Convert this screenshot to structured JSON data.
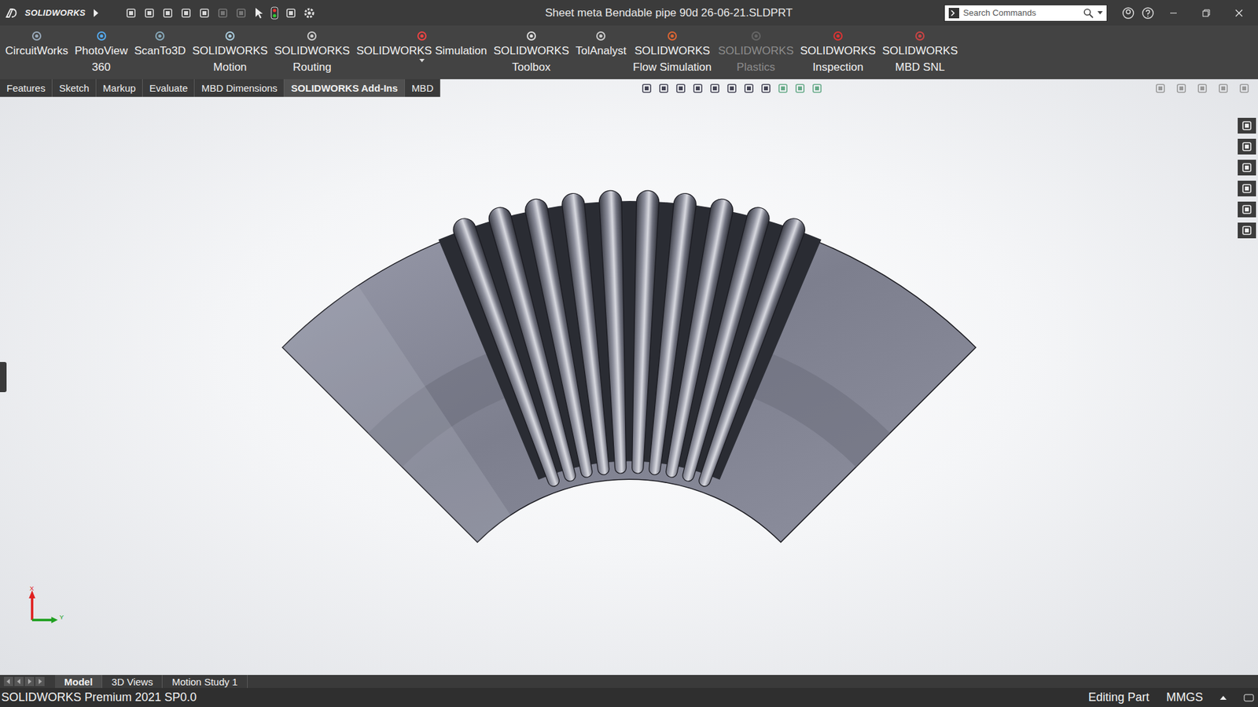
{
  "window": {
    "logo": "SOLIDWORKS",
    "title": "Sheet meta Bendable pipe 90d  26-06-21.SLDPRT"
  },
  "search": {
    "placeholder": "Search Commands"
  },
  "ribbon": [
    {
      "lines": [
        "CircuitWorks"
      ],
      "disabled": false,
      "menu": false
    },
    {
      "lines": [
        "PhotoView",
        "360"
      ],
      "disabled": false,
      "menu": false
    },
    {
      "lines": [
        "ScanTo3D"
      ],
      "disabled": false,
      "menu": false
    },
    {
      "lines": [
        "SOLIDWORKS",
        "Motion"
      ],
      "disabled": false,
      "menu": false
    },
    {
      "lines": [
        "SOLIDWORKS",
        "Routing"
      ],
      "disabled": false,
      "menu": false
    },
    {
      "lines": [
        "SOLIDWORKS Simulation"
      ],
      "disabled": false,
      "menu": true
    },
    {
      "lines": [
        "SOLIDWORKS",
        "Toolbox"
      ],
      "disabled": false,
      "menu": false
    },
    {
      "lines": [
        "TolAnalyst"
      ],
      "disabled": false,
      "menu": false
    },
    {
      "lines": [
        "SOLIDWORKS",
        "Flow Simulation"
      ],
      "disabled": false,
      "menu": false
    },
    {
      "lines": [
        "SOLIDWORKS",
        "Plastics"
      ],
      "disabled": true,
      "menu": false
    },
    {
      "lines": [
        "SOLIDWORKS",
        "Inspection"
      ],
      "disabled": false,
      "menu": false
    },
    {
      "lines": [
        "SOLIDWORKS",
        "MBD SNL"
      ],
      "disabled": false,
      "menu": false
    }
  ],
  "tabs": [
    {
      "label": "Features",
      "selected": false
    },
    {
      "label": "Sketch",
      "selected": false
    },
    {
      "label": "Markup",
      "selected": false
    },
    {
      "label": "Evaluate",
      "selected": false
    },
    {
      "label": "MBD Dimensions",
      "selected": false
    },
    {
      "label": "SOLIDWORKS Add-Ins",
      "selected": true
    },
    {
      "label": "MBD",
      "selected": false
    }
  ],
  "triad": {
    "x": "X",
    "y": "Y"
  },
  "bottom_tabs": [
    {
      "label": "Model",
      "selected": true
    },
    {
      "label": "3D Views",
      "selected": false
    },
    {
      "label": "Motion Study 1",
      "selected": false
    }
  ],
  "status_bar": {
    "product": "SOLIDWORKS Premium 2021 SP0.0",
    "mode": "Editing Part",
    "units": "MMGS"
  }
}
